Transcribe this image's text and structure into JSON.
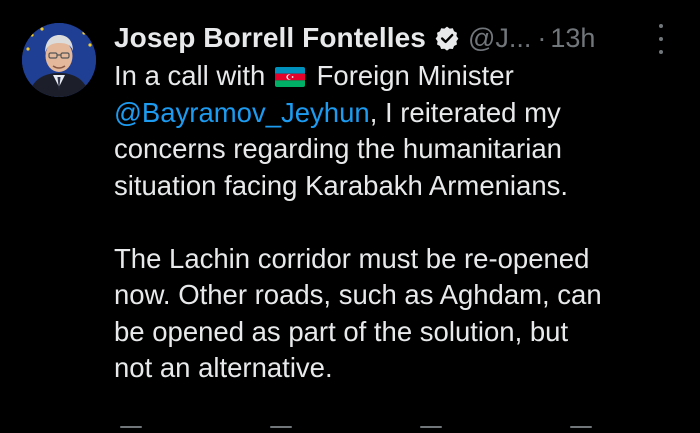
{
  "tweet": {
    "author": {
      "display_name": "Josep Borrell Fontelles",
      "handle": "@J...",
      "separator": "·",
      "time": "13h",
      "verified_icon": "verified-badge-icon",
      "avatar_icon": "avatar"
    },
    "body": {
      "line1_prefix": "In a call with",
      "flag_icon": "azerbaijan-flag-icon",
      "line1_suffix": "Foreign Minister",
      "mention": "@Bayramov_Jeyhun",
      "line2_suffix": ", I reiterated my",
      "line3": "concerns regarding the humanitarian",
      "line4": "situation facing Karabakh Armenians.",
      "line6": "The Lachin corridor must be re-opened",
      "line7": "now. Other roads, such as Aghdam, can",
      "line8": "be opened as part of the solution, but",
      "line9": "not an alternative."
    },
    "more_icon": "more-options-icon"
  },
  "colors": {
    "background": "#000000",
    "text": "#e7e9ea",
    "secondary": "#71767b",
    "link": "#1d9bf0"
  }
}
